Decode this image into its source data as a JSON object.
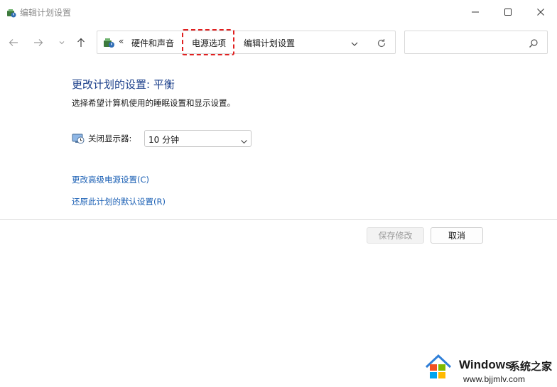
{
  "window": {
    "title": "编辑计划设置"
  },
  "navigation": {
    "breadcrumb": {
      "overflow": "«",
      "items": [
        "硬件和声音",
        "电源选项",
        "编辑计划设置"
      ],
      "highlighted_item": "电源选项",
      "highlight_color": "#e02020"
    },
    "search": {
      "placeholder": ""
    }
  },
  "main": {
    "heading": "更改计划的设置: 平衡",
    "description": "选择希望计算机使用的睡眠设置和显示设置。",
    "display_off": {
      "label": "关闭显示器:",
      "selected": "10 分钟"
    },
    "links": [
      "更改高级电源设置(C)",
      "还原此计划的默认设置(R)"
    ]
  },
  "buttons": {
    "save": "保存修改",
    "save_disabled": true,
    "cancel": "取消"
  },
  "watermark": {
    "brand": "Windows",
    "site_name": "系统之家",
    "url": "www.bjjmlv.com"
  },
  "colors": {
    "heading": "#1a3e8a",
    "link": "#1a5fb4",
    "highlight": "#e02020"
  }
}
